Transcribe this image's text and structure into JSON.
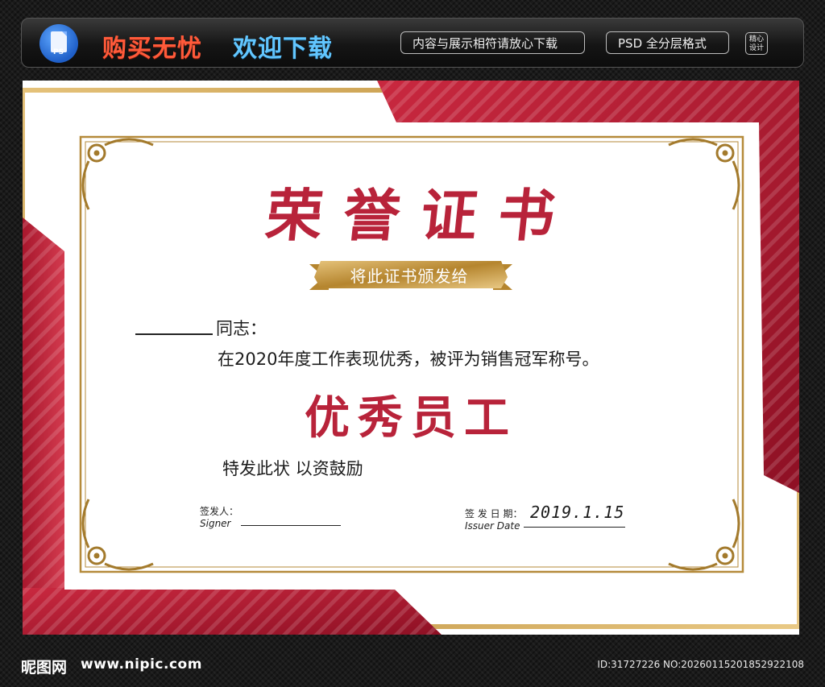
{
  "banner": {
    "icon_label": "PS",
    "slogan_red": "购买无忧",
    "slogan_blue": "欢迎下载",
    "pill_1": "内容与展示相符请放心下载",
    "pill_2": "PSD 全分层格式",
    "badge_line1": "精心",
    "badge_line2": "设计"
  },
  "certificate": {
    "title": "荣誉证书",
    "ribbon": "将此证书颁发给",
    "comrade_suffix": "同志：",
    "body": "在2020年度工作表现优秀，被评为销售冠军称号。",
    "award": "优秀员工",
    "encourage": "特发此状 以资鼓励",
    "signer_cn": "签发人：",
    "signer_en": "Signer",
    "date_cn": "签 发 日 期：",
    "date_en": "Issuer Date",
    "date_value": "2019.1.15"
  },
  "footer": {
    "logo": "昵图网",
    "url": "www.nipic.com",
    "id_text": "ID:31727226 NO:20260115201852922108"
  },
  "colors": {
    "crimson": "#b8233a",
    "gold": "#b58a3a",
    "banner_red": "#ff5a3a",
    "banner_blue": "#62c6ff"
  }
}
